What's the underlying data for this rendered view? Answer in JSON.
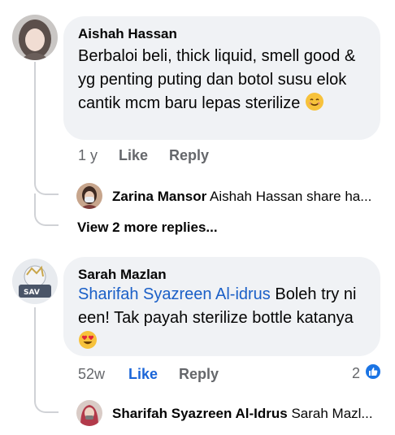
{
  "comments": [
    {
      "author": "Aishah Hassan",
      "text": "Berbaloi beli, thick liquid, smell good & yg penting puting dan botol susu elok cantik mcm baru lepas sterilize",
      "emoji": "smiling-face",
      "time": "1 y",
      "like_label": "Like",
      "reply_label": "Reply",
      "reply_preview": {
        "author": "Zarina Mansor",
        "snippet": "Aishah Hassan share ha..."
      },
      "view_more": "View 2 more replies..."
    },
    {
      "author": "Sarah Mazlan",
      "avatar_text": "SAV",
      "mention": "Sharifah Syazreen Al-idrus",
      "text": "Boleh try ni een! Tak payah sterilize bottle katanya",
      "emoji": "heart-eyes",
      "time": "52w",
      "like_label": "Like",
      "reply_label": "Reply",
      "reaction_count": "2",
      "reply_preview": {
        "author": "Sharifah Syazreen Al-Idrus",
        "snippet": "Sarah Mazl..."
      }
    }
  ],
  "colors": {
    "bubble": "#f0f2f5",
    "secondary_text": "#65676b",
    "link": "#1a5fc7",
    "like_active": "#1a65d8",
    "thread_line": "#d0d2d6"
  }
}
